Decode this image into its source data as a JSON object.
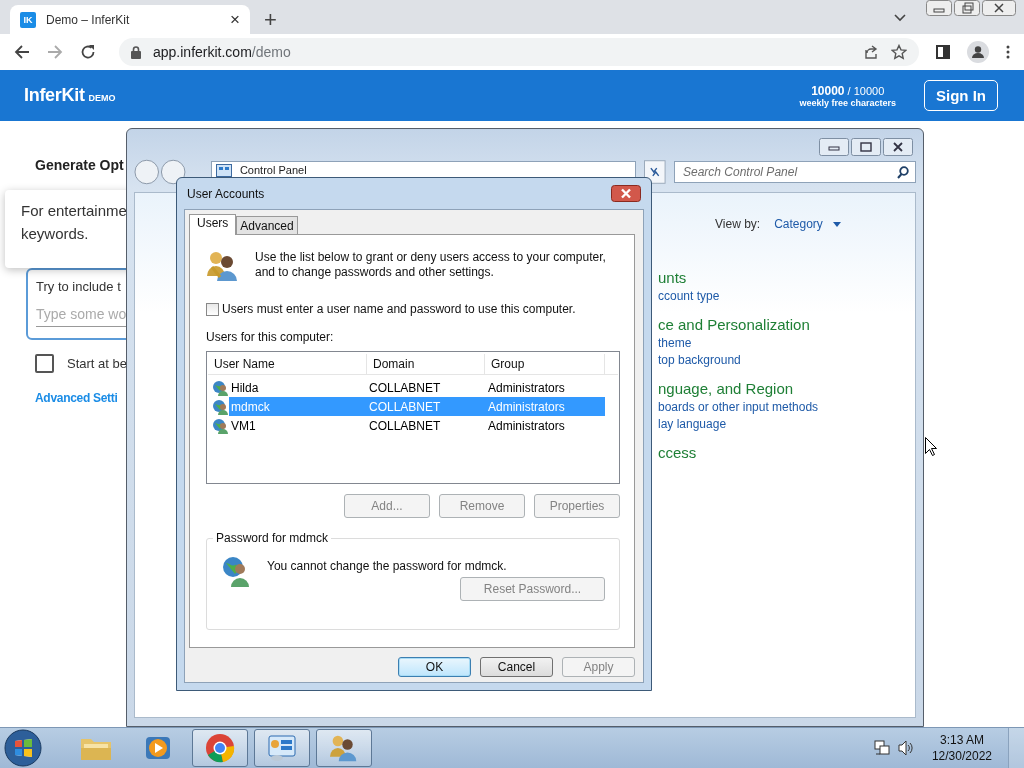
{
  "browser": {
    "tab": {
      "favicon": "IK",
      "title": "Demo – InferKit",
      "close": "×",
      "selected": true
    },
    "new_tab": "+",
    "url_host": "app.inferkit.com",
    "url_path": "/demo"
  },
  "site": {
    "logo": "InferKit",
    "logo_badge": "DEMO",
    "credits_used": "10000",
    "credits_total": "/ 10000",
    "credits_label": "weekly free characters",
    "sign_in": "Sign In",
    "heading": "Generate Opt",
    "tooltip_lines": [
      "For entertainme",
      "keywords."
    ],
    "keyword_label": "Try to include t",
    "keyword_placeholder": "Type some wo",
    "start_checkbox": {
      "label": "Start at be",
      "checked": false
    },
    "advanced_link": "Advanced Setti"
  },
  "control_panel": {
    "breadcrumb": "Control Panel",
    "search_placeholder": "Search Control Panel",
    "view_by_label": "View by:",
    "view_by_value": "Category",
    "categories": [
      {
        "title": "unts",
        "links": [
          "ccount type"
        ]
      },
      {
        "title": "ce and Personalization",
        "links": [
          "theme",
          "top background"
        ]
      },
      {
        "title": "nguage, and Region",
        "links": [
          "boards or other input methods",
          "lay language"
        ]
      },
      {
        "title": "ccess"
      }
    ]
  },
  "dialog": {
    "title": "User Accounts",
    "tabs": [
      {
        "label": "Users",
        "selected": true
      },
      {
        "label": "Advanced",
        "selected": false
      }
    ],
    "intro": "Use the list below to grant or deny users access to your computer,\nand to change passwords and other settings.",
    "require_password": {
      "label": "Users must enter a user name and password to use this computer.",
      "checked": false
    },
    "list_label": "Users for this computer:",
    "columns": [
      "User Name",
      "Domain",
      "Group"
    ],
    "rows": [
      {
        "user_name": "Hilda",
        "domain": "COLLABNET",
        "group": "Administrators",
        "selected": false
      },
      {
        "user_name": "mdmck",
        "domain": "COLLABNET",
        "group": "Administrators",
        "selected": true
      },
      {
        "user_name": "VM1",
        "domain": "COLLABNET",
        "group": "Administrators",
        "selected": false
      }
    ],
    "list_buttons": [
      {
        "label": "Add...",
        "disabled": true
      },
      {
        "label": "Remove",
        "disabled": true
      },
      {
        "label": "Properties",
        "disabled": true
      }
    ],
    "password_group": {
      "title": "Password for mdmck",
      "message": "You cannot change the password for mdmck.",
      "button": {
        "label": "Reset Password...",
        "disabled": true
      }
    },
    "footer_buttons": [
      {
        "label": "OK",
        "disabled": false,
        "default": true
      },
      {
        "label": "Cancel",
        "disabled": false,
        "default": false
      },
      {
        "label": "Apply",
        "disabled": true,
        "default": false
      }
    ]
  },
  "taskbar": {
    "apps": [
      {
        "kind": "explorer",
        "running": false
      },
      {
        "kind": "media",
        "running": false
      },
      {
        "kind": "chrome",
        "running": true
      },
      {
        "kind": "control",
        "running": true
      },
      {
        "kind": "users",
        "running": true
      }
    ],
    "clock": {
      "time": "3:13 AM",
      "date": "12/30/2022"
    }
  }
}
